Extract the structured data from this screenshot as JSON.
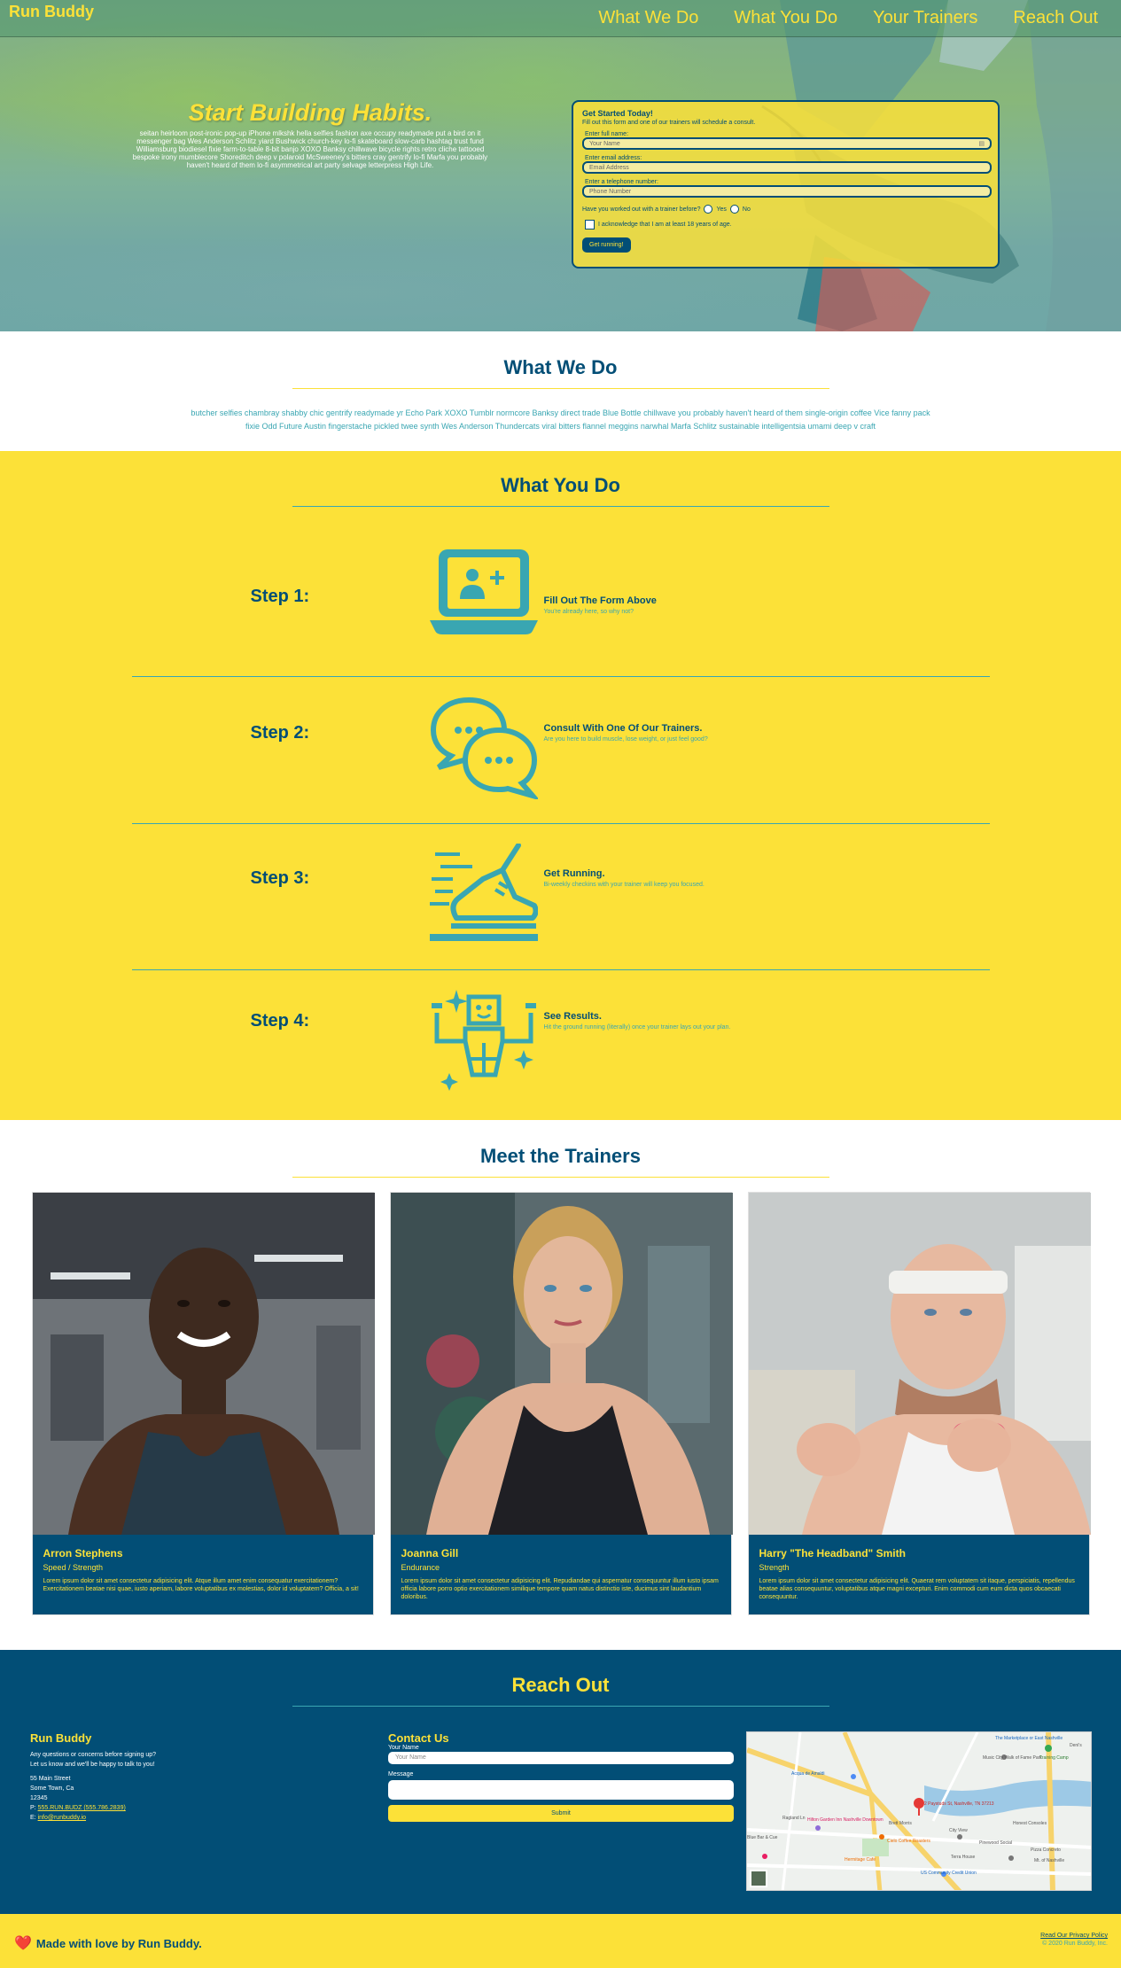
{
  "header": {
    "logo": "Run Buddy",
    "nav": [
      "What We Do",
      "What You Do",
      "Your Trainers",
      "Reach Out"
    ]
  },
  "hero": {
    "title": "Start Building Habits.",
    "text": "seitan heirloom post-ironic pop-up iPhone mlkshk hella selfies fashion axe occupy readymade put a bird on it messenger bag Wes Anderson Schlitz yiard Bushwick church-key lo-fi skateboard slow-carb hashtag trust fund Williamsburg biodiesel fixie farm-to-table 8-bit banjo XOXO Banksy chillwave bicycle rights retro cliche tattooed bespoke irony mumblecore Shoreditch deep v polaroid McSweeney's bitters cray gentrify lo-fi Marfa you probably haven't heard of them lo-fi asymmetrical art party selvage letterpress High Life.",
    "form": {
      "title": "Get Started Today!",
      "subtitle": "Fill out this form and one of our trainers will schedule a consult.",
      "name_label": "Enter full name:",
      "name_placeholder": "Your Name",
      "email_label": "Enter email address:",
      "email_placeholder": "Email Address",
      "phone_label": "Enter a telephone number:",
      "phone_placeholder": "Phone Number",
      "question": "Have you worked out with a trainer before?",
      "yes": "Yes",
      "no": "No",
      "ack": "I acknowledge that I am at least 18 years of age.",
      "submit": "Get running!"
    }
  },
  "what_we_do": {
    "title": "What We Do",
    "text": "butcher selfies chambray shabby chic gentrify readymade yr Echo Park XOXO Tumblr normcore Banksy direct trade Blue Bottle chillwave you probably haven't heard of them single-origin coffee Vice fanny pack fixie Odd Future Austin fingerstache pickled twee synth Wes Anderson Thundercats viral bitters flannel meggins narwhal Marfa Schlitz sustainable intelligentsia umami deep v craft"
  },
  "what_you_do": {
    "title": "What You Do",
    "steps": [
      {
        "label": "Step 1:",
        "title": "Fill Out The Form Above",
        "desc": "You're already here, so why not?",
        "icon": "laptop-add-user-icon"
      },
      {
        "label": "Step 2:",
        "title": "Consult With One Of Our Trainers.",
        "desc": "Are you here to build muscle, lose weight, or just feel good?",
        "icon": "chat-bubbles-icon"
      },
      {
        "label": "Step 3:",
        "title": "Get Running.",
        "desc": "Bi-weekly checkins with your trainer will keep you focused.",
        "icon": "running-shoe-icon"
      },
      {
        "label": "Step 4:",
        "title": "See Results.",
        "desc": "Hit the ground running (literally) once your trainer lays out your plan.",
        "icon": "strong-robot-icon"
      }
    ]
  },
  "trainers": {
    "title": "Meet the Trainers",
    "list": [
      {
        "name": "Arron Stephens",
        "role": "Speed / Strength",
        "bio": "Lorem ipsum dolor sit amet consectetur adipisicing elit. Atque illum amet enim consequatur exercitationem? Exercitationem beatae nisi quae, iusto aperiam, labore voluptatibus ex molestias, dolor id voluptatem? Officia, a sit!"
      },
      {
        "name": "Joanna Gill",
        "role": "Endurance",
        "bio": "Lorem ipsum dolor sit amet consectetur adipisicing elit. Repudiandae qui aspernatur consequuntur illum iusto ipsam officia labore porro optio exercitationem similique tempore quam natus distinctio iste, ducimus sint laudantium doloribus."
      },
      {
        "name": "Harry \"The Headband\" Smith",
        "role": "Strength",
        "bio": "Lorem ipsum dolor sit amet consectetur adipisicing elit. Quaerat rem voluptatem sit itaque, perspiciatis, repellendus beatae alias consequuntur, voluptatibus atque magni excepturi. Enim commodi cum eum dicta quos obcaecati consequuntur."
      }
    ]
  },
  "reach_out": {
    "title": "Reach Out",
    "info": {
      "title": "Run Buddy",
      "line1": "Any questions or concerns before signing up?",
      "line2": "Let us know and we'll be happy to talk to you!",
      "street": "55 Main Street",
      "city": "Some Town, Ca",
      "zip": "12345",
      "phone_prefix": "P:",
      "phone": "555.RUN.BUDZ (555.786.2839)",
      "email_prefix": "E:",
      "email": "info@runbuddy.io"
    },
    "contact": {
      "title": "Contact Us",
      "name_label": "Your Name",
      "name_placeholder": "Your Name",
      "message_label": "Message",
      "submit": "Submit"
    },
    "map": {
      "pin_label": "2 Paystuds St, Nashville, TN 37213",
      "places": [
        "The Marketplace or East Nashville",
        "Training Camp",
        "Deni's",
        "Music City Walk of Fame Park",
        "Acqua de Amaldi",
        "Ragland Ln",
        "Hilton Garden Inn Nashville Downtown",
        "Brett Morris",
        "Honest Consoles",
        "City View",
        "Blue Bar & Cue",
        "Cielo Coffee Roasters",
        "Pinewood Social",
        "Hermitage Cafe",
        "Terra House",
        "US Community Credit Union",
        "Pizza Concreto",
        "Mt. of Nashville"
      ]
    }
  },
  "footer": {
    "heart": "❤️",
    "made_with": "Made with love by Run Buddy.",
    "privacy": "Read Our Privacy Policy",
    "copyright": "© 2020 Run Buddy, Inc."
  },
  "colors": {
    "primary": "#024e76",
    "accent": "#fce138",
    "secondary": "#39a6b2"
  }
}
